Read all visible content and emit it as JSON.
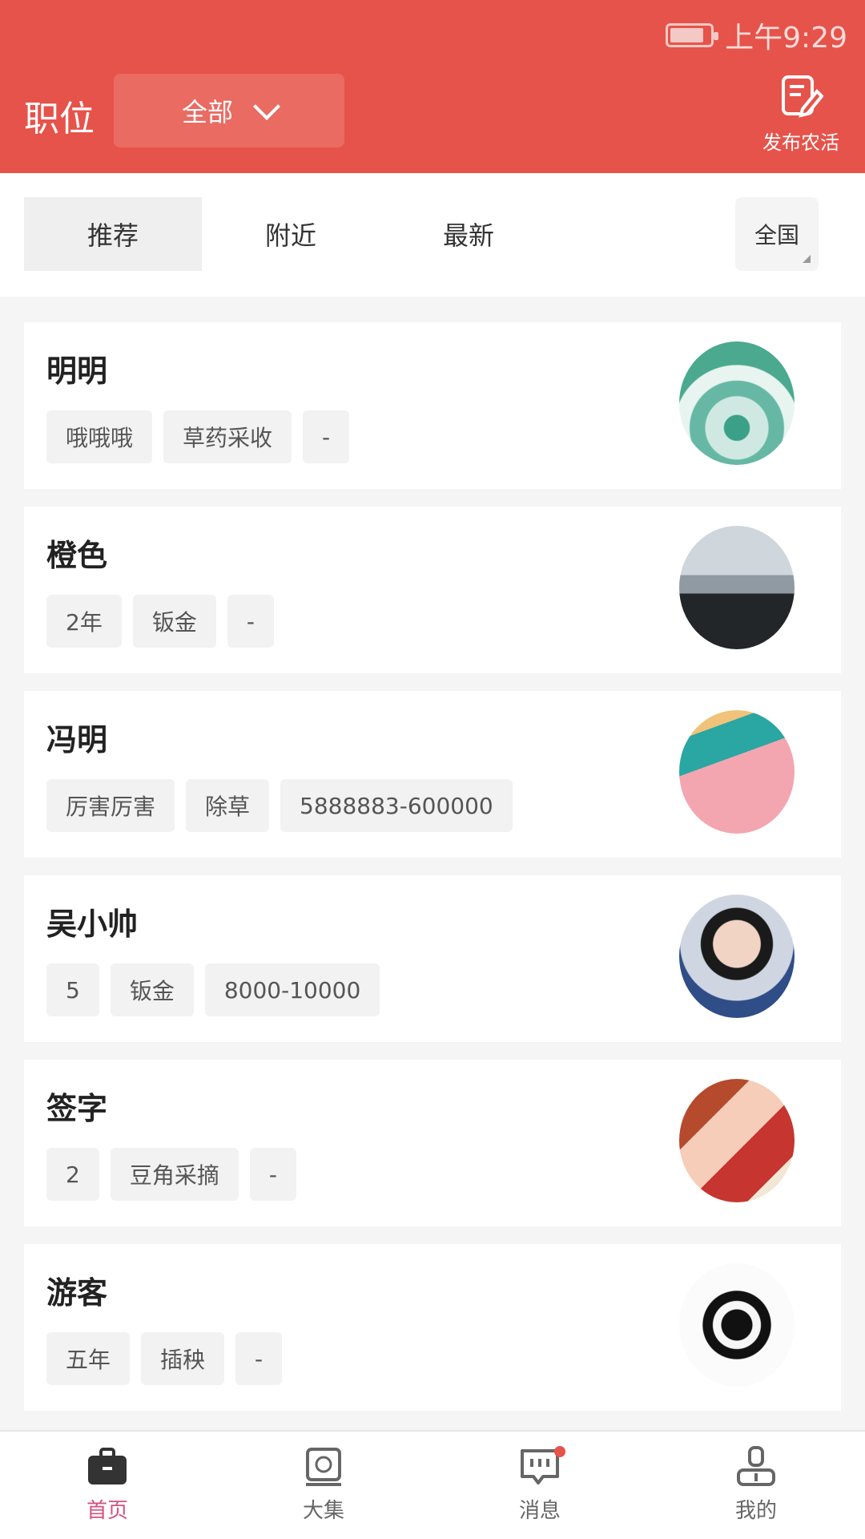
{
  "status": {
    "time": "上午9:29",
    "battery_level": 0.75
  },
  "header": {
    "title": "职位",
    "dropdown_value": "全部",
    "publish_label": "发布农活"
  },
  "filters": {
    "tabs": [
      {
        "label": "推荐",
        "active": true
      },
      {
        "label": "附近",
        "active": false
      },
      {
        "label": "最新",
        "active": false
      }
    ],
    "region": "全国"
  },
  "cards": [
    {
      "name": "明明",
      "tags": [
        "哦哦哦",
        "草药采收",
        "-"
      ],
      "avatar": "water-drop-avatar"
    },
    {
      "name": "橙色",
      "tags": [
        "2年",
        "钣金",
        "-"
      ],
      "avatar": "car-dashboard-avatar"
    },
    {
      "name": "冯明",
      "tags": [
        "厉害厉害",
        "除草",
        "5888883-600000"
      ],
      "avatar": "pink-wall-avatar"
    },
    {
      "name": "吴小帅",
      "tags": [
        "5",
        "钣金",
        "8000-10000"
      ],
      "avatar": "boy-portrait-avatar"
    },
    {
      "name": "签字",
      "tags": [
        "2",
        "豆角采摘",
        "-"
      ],
      "avatar": "anime-girl-avatar"
    },
    {
      "name": "游客",
      "tags": [
        "五年",
        "插秧",
        "-"
      ],
      "avatar": "calligraphy-avatar"
    }
  ],
  "bottom_nav": [
    {
      "label": "首页",
      "active": true,
      "icon": "briefcase-icon"
    },
    {
      "label": "大集",
      "active": false,
      "icon": "market-icon"
    },
    {
      "label": "消息",
      "active": false,
      "icon": "message-icon",
      "badge": true
    },
    {
      "label": "我的",
      "active": false,
      "icon": "profile-icon"
    }
  ],
  "colors": {
    "brand": "#e6534a",
    "nav_active": "#d4537e"
  }
}
